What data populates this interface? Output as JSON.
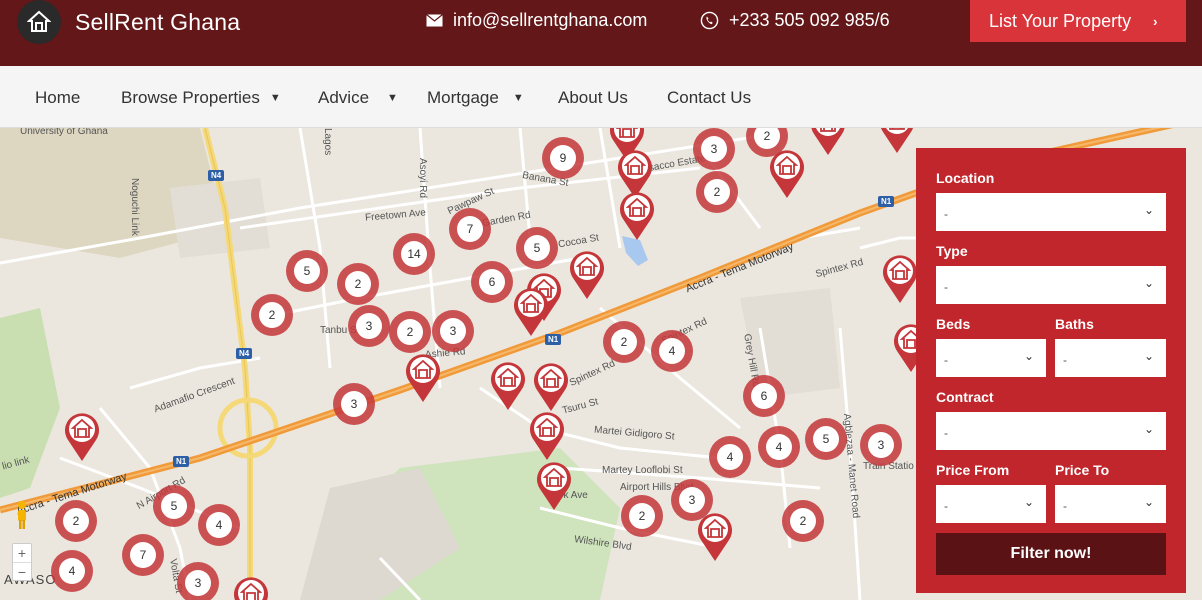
{
  "header": {
    "brand": "SellRent Ghana",
    "email": "info@sellrentghana.com",
    "phone": "+233 505 092 985/6",
    "cta_label": "List Your Property"
  },
  "nav": {
    "items": [
      {
        "label": "Home",
        "has_caret": false
      },
      {
        "label": "Browse Properties",
        "has_caret": true
      },
      {
        "label": "Advice",
        "has_caret": true
      },
      {
        "label": "Mortgage",
        "has_caret": true
      },
      {
        "label": "About Us",
        "has_caret": false
      },
      {
        "label": "Contact Us",
        "has_caret": false
      }
    ]
  },
  "map": {
    "labels": {
      "univ": "University of Ghana",
      "noguchi": "Noguchi Link",
      "lagos": "Lagos",
      "asoyi": "Asoyi Rd",
      "banana": "Banana St",
      "pawpaw": "Pawpaw St",
      "freetown": "Freetown Ave",
      "garden": "Garden Rd",
      "cocoa": "Cocoa St",
      "trasacco": "Trasacco Estate Rd",
      "motorway1": "Accra - Tema Motorway",
      "motorway2": "Accra - Tema Motorway",
      "spintex_top": "Spintex Rd",
      "spintex_mid": "Spintex Rd",
      "spintex_low": "Spintex Rd",
      "tanbu": "Tanbu St",
      "ashie": "Ashie Rd",
      "adamafio": "Adamafio Crescent",
      "tsuru": "Tsuru St",
      "gidigoro": "Martei Gidigoro St",
      "looflobi": "Martey Looflobi St",
      "airport_hills": "Airport Hills Blvd",
      "park": "Park Ave",
      "wilshire": "Wilshire Blvd",
      "greyhill": "Grey Hill Rd",
      "agblezaa": "Agblezaa - Manet Road",
      "train": "Train Statio",
      "airport": "N Airport Rd",
      "volta": "Volta St",
      "awaso": "AWASO",
      "lio": "lio link",
      "n1_a": "N1",
      "n1_b": "N1",
      "n1_c": "N1",
      "n4_a": "N4",
      "n4_b": "N4"
    },
    "clusters": [
      "9",
      "3",
      "2",
      "2",
      "2",
      "7",
      "5",
      "14",
      "5",
      "6",
      "2",
      "2",
      "3",
      "2",
      "3",
      "2",
      "4",
      "3",
      "6",
      "4",
      "5",
      "3",
      "4",
      "3",
      "2",
      "2",
      "5",
      "4",
      "7",
      "4",
      "3",
      "2"
    ]
  },
  "filter": {
    "location_label": "Location",
    "location_value": "-",
    "type_label": "Type",
    "type_value": "-",
    "beds_label": "Beds",
    "beds_value": "-",
    "baths_label": "Baths",
    "baths_value": "-",
    "contract_label": "Contract",
    "contract_value": "-",
    "price_from_label": "Price From",
    "price_from_value": "-",
    "price_to_label": "Price To",
    "price_to_value": "-",
    "submit_label": "Filter now!"
  },
  "colors": {
    "header_bg": "#641718",
    "cta_bg": "#d9343a",
    "panel_bg": "#c0262b",
    "button_bg": "#5b1214",
    "marker": "#c43639"
  }
}
